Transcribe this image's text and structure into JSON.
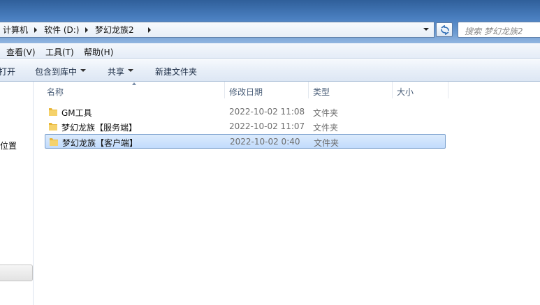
{
  "breadcrumb": [
    "计算机",
    "软件 (D:)",
    "梦幻龙族2"
  ],
  "search": {
    "placeholder": "搜索 梦幻龙族2"
  },
  "menu": [
    "查看(V)",
    "工具(T)",
    "帮助(H)"
  ],
  "commands": {
    "open": "打开",
    "include_library": "包含到库中",
    "share": "共享",
    "new_folder": "新建文件夹"
  },
  "nav": {
    "location": "位置"
  },
  "columns": {
    "name": "名称",
    "modified": "修改日期",
    "type": "类型",
    "size": "大小"
  },
  "files": [
    {
      "name": "GM工具",
      "modified": "2022-10-02 11:08",
      "type": "文件夹",
      "selected": false
    },
    {
      "name": "梦幻龙族【服务端】",
      "modified": "2022-10-02 11:07",
      "type": "文件夹",
      "selected": false
    },
    {
      "name": "梦幻龙族【客户端】",
      "modified": "2022-10-02 0:40",
      "type": "文件夹",
      "selected": true
    }
  ],
  "colors": {
    "selection": "#cce0fb",
    "selection_border": "#7da2ce",
    "titlebar": "#4a7fc0"
  },
  "icons": {
    "folder": "folder-icon",
    "refresh": "refresh-icon"
  }
}
